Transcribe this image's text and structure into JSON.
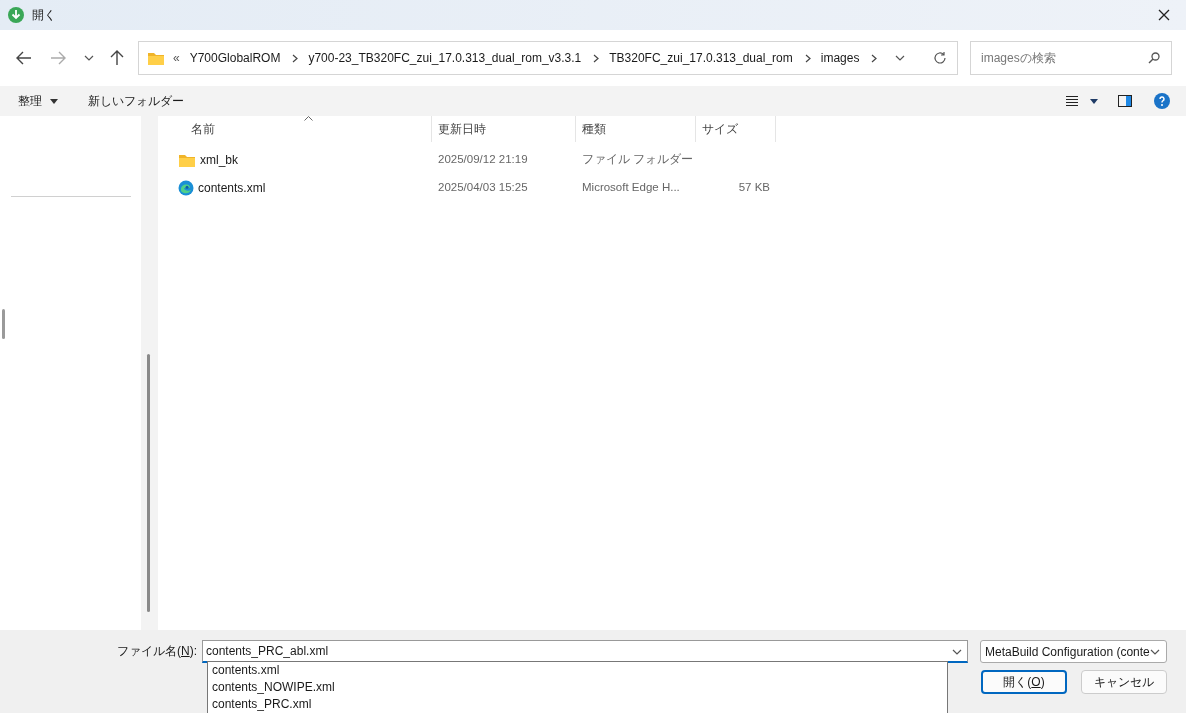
{
  "window": {
    "title": "開く"
  },
  "nav": {
    "back_disabled": false,
    "forward_disabled": true,
    "overflow": "«",
    "breadcrumbs": [
      "Y700GlobalROM",
      "y700-23_TB320FC_zui_17.0.313_dual_rom_v3.3.1",
      "TB320FC_zui_17.0.313_dual_rom",
      "images"
    ],
    "search": {
      "placeholder": "imagesの検索"
    }
  },
  "toolbar": {
    "organize": "整理",
    "new_folder": "新しいフォルダー"
  },
  "table": {
    "columns": [
      "名前",
      "更新日時",
      "種類",
      "サイズ"
    ],
    "rows": [
      {
        "kind": "folder",
        "name": "xml_bk",
        "modified": "2025/09/12 21:19",
        "type": "ファイル フォルダー",
        "size": ""
      },
      {
        "kind": "edge",
        "name": "contents.xml",
        "modified": "2025/04/03 15:25",
        "type": "Microsoft Edge H...",
        "size": "57 KB"
      }
    ]
  },
  "footer": {
    "filename_label": [
      "ファイル名(",
      "N",
      "):"
    ],
    "filename": {
      "value": "contents_PRC_abl.xml"
    },
    "suggestions": [
      "contents.xml",
      "contents_NOWIPE.xml",
      "contents_PRC.xml"
    ],
    "filter": "MetaBuild Configuration (conte",
    "open_button": [
      "開く(",
      "O",
      ")"
    ],
    "cancel_button": "キャンセル"
  }
}
